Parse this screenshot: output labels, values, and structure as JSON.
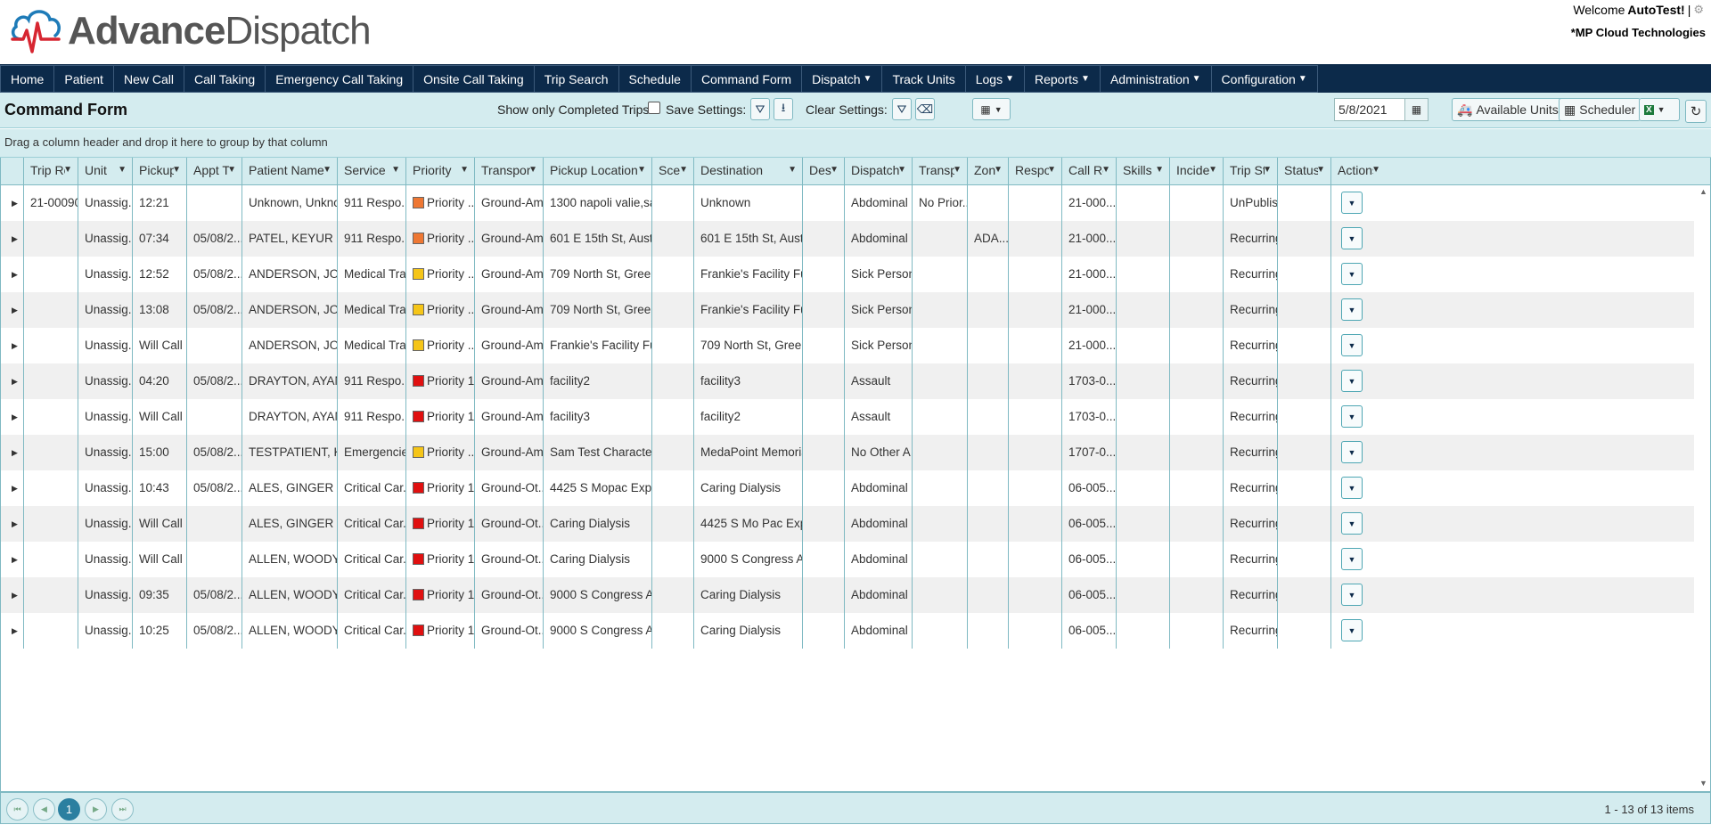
{
  "app": {
    "logo_bold": "Advance",
    "logo_light": "Dispatch",
    "welcome_prefix": "Welcome ",
    "username": "AutoTest!",
    "org": "*MP Cloud Technologies"
  },
  "nav": [
    {
      "label": "Home",
      "dd": false
    },
    {
      "label": "Patient",
      "dd": false
    },
    {
      "label": "New Call",
      "dd": false
    },
    {
      "label": "Call Taking",
      "dd": false
    },
    {
      "label": "Emergency Call Taking",
      "dd": false
    },
    {
      "label": "Onsite Call Taking",
      "dd": false
    },
    {
      "label": "Trip Search",
      "dd": false
    },
    {
      "label": "Schedule",
      "dd": false
    },
    {
      "label": "Command Form",
      "dd": false
    },
    {
      "label": "Dispatch",
      "dd": true
    },
    {
      "label": "Track Units",
      "dd": false
    },
    {
      "label": "Logs",
      "dd": true
    },
    {
      "label": "Reports",
      "dd": true
    },
    {
      "label": "Administration",
      "dd": true
    },
    {
      "label": "Configuration",
      "dd": true
    }
  ],
  "toolbar": {
    "title": "Command Form",
    "show_completed_label": "Show only Completed Trips:",
    "save_settings_label": "Save Settings:",
    "clear_settings_label": "Clear Settings:",
    "date_value": "5/8/2021",
    "available_units_label": "Available Units",
    "scheduler_label": "Scheduler"
  },
  "grouping_hint": "Drag a column header and drop it here to group by that column",
  "columns": [
    "",
    "Trip Re",
    "Unit",
    "Pickup",
    "Appt T",
    "Patient Name",
    "Service",
    "Priority",
    "Transport",
    "Pickup Location",
    "Sce",
    "Destination",
    "Des",
    "Dispatch C",
    "Transpo",
    "Zon",
    "Respor",
    "Call Re",
    "Skills",
    "Inciden",
    "Trip St",
    "Status",
    "Actions"
  ],
  "rows": [
    {
      "trip": "21-00090",
      "unit": "Unassig...",
      "pickup": "12:21",
      "appt": "",
      "patient": "Unknown, Unkno...",
      "service": "911 Respo...",
      "priority": "Priority ...",
      "pcolor": "#ee7733",
      "transport": "Ground-Am...",
      "ploc": "1300 napoli valie,san ...",
      "sce": "",
      "dest": "Unknown",
      "des": "",
      "dispc": "Abdominal ...",
      "transpo": "No Prior...",
      "zone": "",
      "resp": "",
      "callref": "21-000...",
      "skills": "",
      "incid": "",
      "tripst": "UnPublishe",
      "status": ""
    },
    {
      "trip": "",
      "unit": "Unassig...",
      "pickup": "07:34",
      "appt": "05/08/2...",
      "patient": "PATEL, KEYUR",
      "service": "911 Respo...",
      "priority": "Priority ...",
      "pcolor": "#ee7733",
      "transport": "Ground-Am...",
      "ploc": "601 E 15th St, Austin...",
      "sce": "",
      "dest": "601 E 15th St, Austin...",
      "des": "",
      "dispc": "Abdominal ...",
      "transpo": "",
      "zone": "ADA...",
      "resp": "",
      "callref": "21-000...",
      "skills": "",
      "incid": "",
      "tripst": "Recurring",
      "status": ""
    },
    {
      "trip": "",
      "unit": "Unassig...",
      "pickup": "12:52",
      "appt": "05/08/2...",
      "patient": "ANDERSON, JOH...",
      "service": "Medical Tra...",
      "priority": "Priority ...",
      "pcolor": "#f5c518",
      "transport": "Ground-Am...",
      "ploc": "709 North St, Green ...",
      "sce": "",
      "dest": "Frankie's Facility Fun...",
      "des": "",
      "dispc": "Sick Person",
      "transpo": "",
      "zone": "",
      "resp": "",
      "callref": "21-000...",
      "skills": "",
      "incid": "",
      "tripst": "Recurring",
      "status": ""
    },
    {
      "trip": "",
      "unit": "Unassig...",
      "pickup": "13:08",
      "appt": "05/08/2...",
      "patient": "ANDERSON, JOH...",
      "service": "Medical Tra...",
      "priority": "Priority ...",
      "pcolor": "#f5c518",
      "transport": "Ground-Am...",
      "ploc": "709 North St, Green ...",
      "sce": "",
      "dest": "Frankie's Facility Fun...",
      "des": "",
      "dispc": "Sick Person",
      "transpo": "",
      "zone": "",
      "resp": "",
      "callref": "21-000...",
      "skills": "",
      "incid": "",
      "tripst": "Recurring",
      "status": ""
    },
    {
      "trip": "",
      "unit": "Unassig...",
      "pickup": "Will Call",
      "appt": "",
      "patient": "ANDERSON, JOH...",
      "service": "Medical Tra...",
      "priority": "Priority ...",
      "pcolor": "#f5c518",
      "transport": "Ground-Am...",
      "ploc": "Frankie's Facility Fun...",
      "sce": "",
      "dest": "709 North St, Green ...",
      "des": "",
      "dispc": "Sick Person",
      "transpo": "",
      "zone": "",
      "resp": "",
      "callref": "21-000...",
      "skills": "",
      "incid": "",
      "tripst": "Recurring",
      "status": ""
    },
    {
      "trip": "",
      "unit": "Unassig...",
      "pickup": "04:20",
      "appt": "05/08/2...",
      "patient": "DRAYTON, AYANA",
      "service": "911 Respo...",
      "priority": "Priority 1",
      "pcolor": "#e01010",
      "transport": "Ground-Am...",
      "ploc": "facility2",
      "sce": "",
      "dest": "facility3",
      "des": "",
      "dispc": "Assault",
      "transpo": "",
      "zone": "",
      "resp": "",
      "callref": "1703-0...",
      "skills": "",
      "incid": "",
      "tripst": "Recurring",
      "status": ""
    },
    {
      "trip": "",
      "unit": "Unassig...",
      "pickup": "Will Call",
      "appt": "",
      "patient": "DRAYTON, AYANA",
      "service": "911 Respo...",
      "priority": "Priority 1",
      "pcolor": "#e01010",
      "transport": "Ground-Am...",
      "ploc": "facility3",
      "sce": "",
      "dest": "facility2",
      "des": "",
      "dispc": "Assault",
      "transpo": "",
      "zone": "",
      "resp": "",
      "callref": "1703-0...",
      "skills": "",
      "incid": "",
      "tripst": "Recurring",
      "status": ""
    },
    {
      "trip": "",
      "unit": "Unassig...",
      "pickup": "15:00",
      "appt": "05/08/2...",
      "patient": "TESTPATIENT, KA...",
      "service": "Emergencies",
      "priority": "Priority ...",
      "pcolor": "#f5c518",
      "transport": "Ground-Am...",
      "ploc": "Sam Test Character F...",
      "sce": "",
      "dest": "MedaPoint Memorial ...",
      "des": "",
      "dispc": "No Other A...",
      "transpo": "",
      "zone": "",
      "resp": "",
      "callref": "1707-0...",
      "skills": "",
      "incid": "",
      "tripst": "Recurring",
      "status": ""
    },
    {
      "trip": "",
      "unit": "Unassig...",
      "pickup": "10:43",
      "appt": "05/08/2...",
      "patient": "ALES, GINGER",
      "service": "Critical Car...",
      "priority": "Priority 1",
      "pcolor": "#e01010",
      "transport": "Ground-Ot...",
      "ploc": "4425 S Mopac Expy, ...",
      "sce": "",
      "dest": "Caring Dialysis",
      "des": "",
      "dispc": "Abdominal ...",
      "transpo": "",
      "zone": "",
      "resp": "",
      "callref": "06-005...",
      "skills": "",
      "incid": "",
      "tripst": "Recurring",
      "status": ""
    },
    {
      "trip": "",
      "unit": "Unassig...",
      "pickup": "Will Call",
      "appt": "",
      "patient": "ALES, GINGER",
      "service": "Critical Car...",
      "priority": "Priority 1",
      "pcolor": "#e01010",
      "transport": "Ground-Ot...",
      "ploc": "Caring Dialysis",
      "sce": "",
      "dest": "4425 S Mo Pac Expy, ...",
      "des": "",
      "dispc": "Abdominal ...",
      "transpo": "",
      "zone": "",
      "resp": "",
      "callref": "06-005...",
      "skills": "",
      "incid": "",
      "tripst": "Recurring",
      "status": ""
    },
    {
      "trip": "",
      "unit": "Unassig...",
      "pickup": "Will Call",
      "appt": "",
      "patient": "ALLEN, WOODY",
      "service": "Critical Car...",
      "priority": "Priority 1",
      "pcolor": "#e01010",
      "transport": "Ground-Ot...",
      "ploc": "Caring Dialysis",
      "sce": "",
      "dest": "9000 S Congress Ave...",
      "des": "",
      "dispc": "Abdominal ...",
      "transpo": "",
      "zone": "",
      "resp": "",
      "callref": "06-005...",
      "skills": "",
      "incid": "",
      "tripst": "Recurring",
      "status": ""
    },
    {
      "trip": "",
      "unit": "Unassig...",
      "pickup": "09:35",
      "appt": "05/08/2...",
      "patient": "ALLEN, WOODY",
      "service": "Critical Car...",
      "priority": "Priority 1",
      "pcolor": "#e01010",
      "transport": "Ground-Ot...",
      "ploc": "9000 S Congress Ave...",
      "sce": "",
      "dest": "Caring Dialysis",
      "des": "",
      "dispc": "Abdominal ...",
      "transpo": "",
      "zone": "",
      "resp": "",
      "callref": "06-005...",
      "skills": "",
      "incid": "",
      "tripst": "Recurring",
      "status": ""
    },
    {
      "trip": "",
      "unit": "Unassig...",
      "pickup": "10:25",
      "appt": "05/08/2...",
      "patient": "ALLEN, WOODY",
      "service": "Critical Car...",
      "priority": "Priority 1",
      "pcolor": "#e01010",
      "transport": "Ground-Ot...",
      "ploc": "9000 S Congress Ave...",
      "sce": "",
      "dest": "Caring Dialysis",
      "des": "",
      "dispc": "Abdominal ...",
      "transpo": "",
      "zone": "",
      "resp": "",
      "callref": "06-005...",
      "skills": "",
      "incid": "",
      "tripst": "Recurring",
      "status": ""
    }
  ],
  "pager": {
    "current_page": "1",
    "info": "1 - 13 of 13 items"
  },
  "colors": {
    "nav_bg": "#0c2a4a",
    "toolbar_bg": "#d4ecef",
    "grid_border": "#7fb9c2",
    "accent": "#2b7fa0"
  }
}
